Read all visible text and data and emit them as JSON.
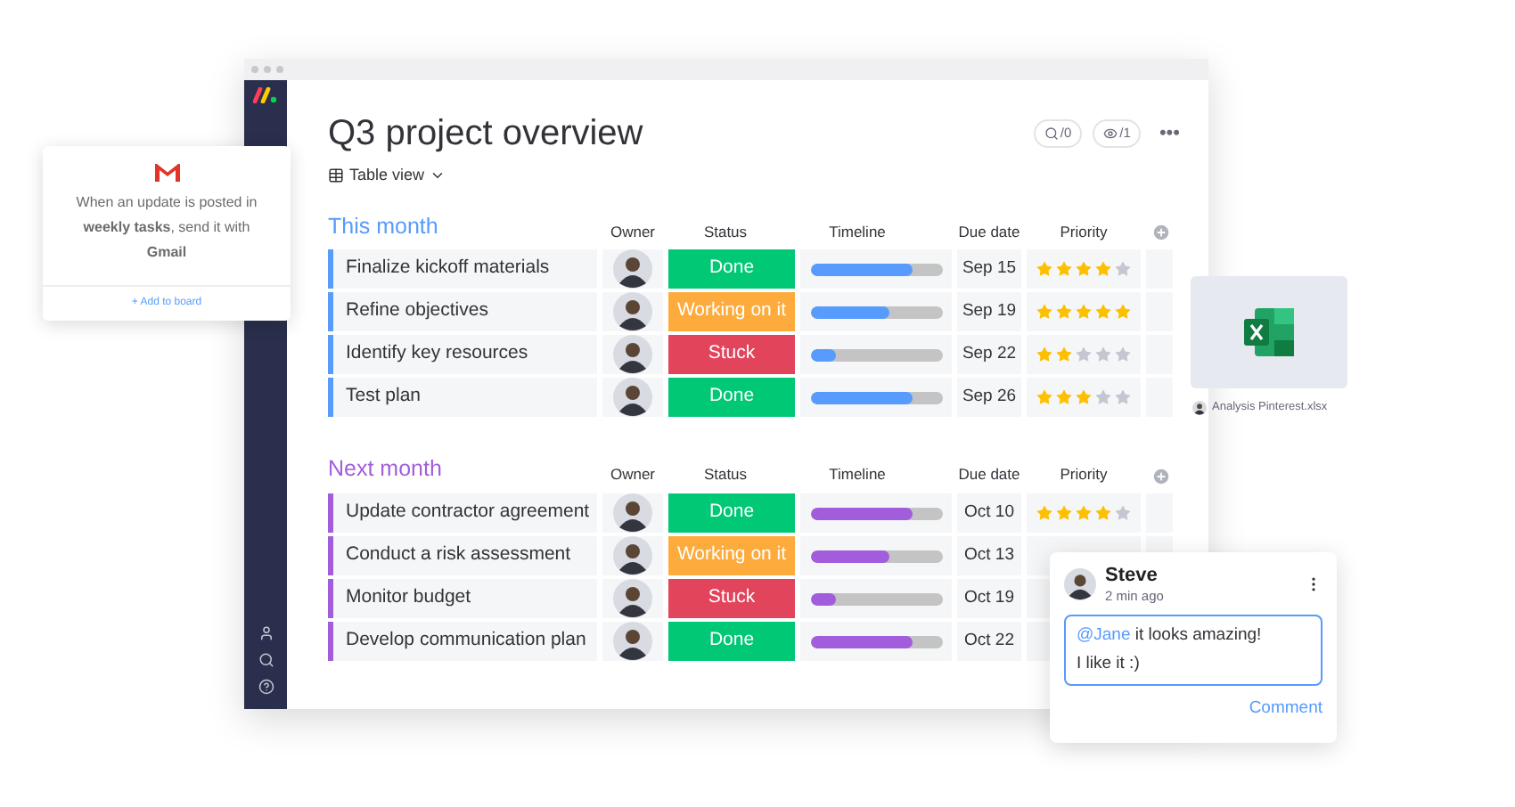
{
  "integration_card": {
    "lines": "When an update is posted in **weekly tasks**, send it with **Gmail**",
    "link": "+ Add to board"
  },
  "board": {
    "title": "Q3 project overview",
    "view": "Table view",
    "counters": [
      {
        "kind": "activity",
        "text": "/0"
      },
      {
        "kind": "viewers",
        "text": "/1"
      }
    ],
    "more": "•••",
    "groups": [
      {
        "title": "This month",
        "color": "#579bfc",
        "columns": [
          "Owner",
          "Status",
          "Timeline",
          "Due date",
          "Priority"
        ],
        "rows": [
          {
            "name": "Finalize kickoff materials",
            "status": "Done",
            "kind": "done",
            "level": 0.78,
            "due": "Sep 15",
            "stars": 4
          },
          {
            "name": "Refine objectives",
            "status": "Working on it",
            "kind": "working",
            "level": 0.6,
            "due": "Sep 19",
            "stars": 5
          },
          {
            "name": "Identify key resources",
            "status": "Stuck",
            "kind": "stuck",
            "level": 0.2,
            "due": "Sep 22",
            "stars": 2
          },
          {
            "name": "Test plan",
            "status": "Done",
            "kind": "done",
            "level": 0.78,
            "due": "Sep 26",
            "stars": 3
          }
        ]
      },
      {
        "title": "Next month",
        "color": "#a25ddc",
        "columns": [
          "Owner",
          "Status",
          "Timeline",
          "Due date",
          "Priority"
        ],
        "rows": [
          {
            "name": "Update contractor agreement",
            "status": "Done",
            "kind": "done",
            "level": 0.78,
            "due": "Oct 10",
            "stars": 4
          },
          {
            "name": "Conduct a risk assessment",
            "status": "Working on it",
            "kind": "working",
            "level": 0.6,
            "due": "Oct 13"
          },
          {
            "name": "Monitor budget",
            "status": "Stuck",
            "kind": "stuck",
            "level": 0.2,
            "due": "Oct 19"
          },
          {
            "name": "Develop communication plan",
            "status": "Done",
            "kind": "done",
            "level": 0.78,
            "due": "Oct 22"
          }
        ]
      }
    ]
  },
  "file_card": {
    "filename": "Analysis Pinterest.xlsx"
  },
  "comment": {
    "author": "Steve",
    "time": "2 min ago",
    "mention": "@Jane",
    "text": "it looks amazing!",
    "line2": "I like it :)",
    "action": "Comment"
  }
}
